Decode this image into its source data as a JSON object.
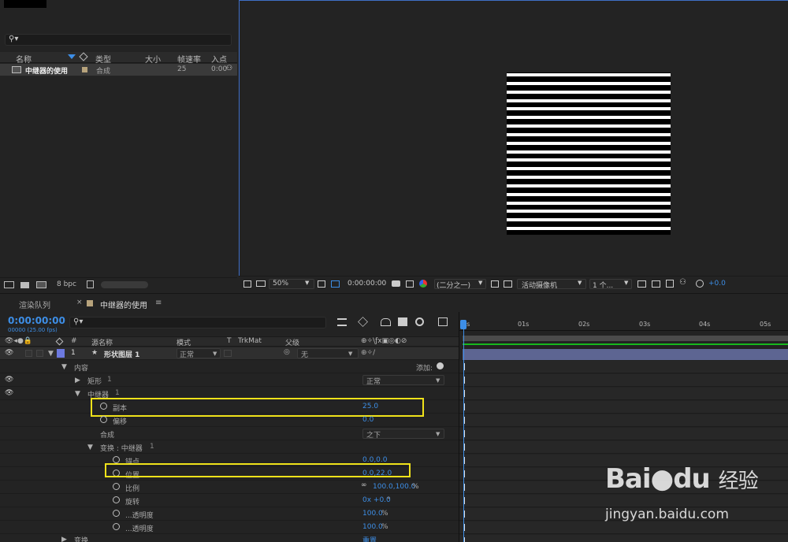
{
  "project": {
    "search_glyph": "⚲▾",
    "columns": {
      "name": "名称",
      "type": "类型",
      "size": "大小",
      "fps": "帧速率",
      "in": "入点"
    },
    "items": [
      {
        "name": "中继器的使用",
        "type": "合成",
        "fps": "25",
        "in": "0:00"
      }
    ],
    "footer": {
      "bpc": "8 bpc"
    }
  },
  "viewer": {
    "zoom": "50%",
    "timecode": "0:00:00:00",
    "resolution": "(二分之一)",
    "camera": "活动摄像机",
    "views": "1 个...",
    "exposure": "+0.0",
    "stripe_count": 19
  },
  "timeline": {
    "tabs": {
      "render_queue": "渲染队列",
      "comp": "中继器的使用",
      "close": "×",
      "menu": "≡"
    },
    "timecode": "0:00:00:00",
    "fps_label": "00000 (25.00 fps)",
    "columns": {
      "source_name": "源名称",
      "mode": "模式",
      "t": "T",
      "trkmat": "TrkMat",
      "parent": "父级",
      "hash": "#"
    },
    "layer": {
      "index": "1",
      "name": "形状图层 1",
      "mode": "正常",
      "parent": "无",
      "star": "★"
    },
    "rows": {
      "contents": "内容",
      "add_label": "添加:",
      "rect": "矩形",
      "rect_num": "1",
      "rect_mode": "正常",
      "repeater": "中继器",
      "repeater_num": "1",
      "copies_label": "副本",
      "copies_value": "25.0",
      "offset_label": "偏移",
      "offset_value": "0.0",
      "composite_label": "合成",
      "composite_value": "之下",
      "transform_repeater": "变换 : 中继器",
      "transform_repeater_num": "1",
      "anchor_label": "锚点",
      "anchor_value": "0.0,0.0",
      "position_label": "位置",
      "position_value": "0.0,22.0",
      "scale_label": "比例",
      "scale_value": "100.0,100.0",
      "scale_unit": "%",
      "rotation_label": "旋转",
      "rotation_value": "0x +0.0",
      "rotation_unit": "°",
      "start_opacity_label": "...透明度",
      "start_opacity_value": "100.0",
      "end_opacity_label": "...透明度",
      "end_opacity_value": "100.0",
      "opacity_unit": "%",
      "transform_label": "变换",
      "reset_label": "重置"
    },
    "ruler": [
      "0s",
      "01s",
      "02s",
      "03s",
      "04s",
      "05s"
    ]
  },
  "watermark": {
    "brand": "Bai",
    "paw": "du",
    "cn": "经验",
    "url": "jingyan.baidu.com"
  },
  "colors": {
    "accent": "#3d8ee6",
    "highlight": "#f0e21a",
    "layer_bar": "#5d6592",
    "green": "#17b81d"
  }
}
